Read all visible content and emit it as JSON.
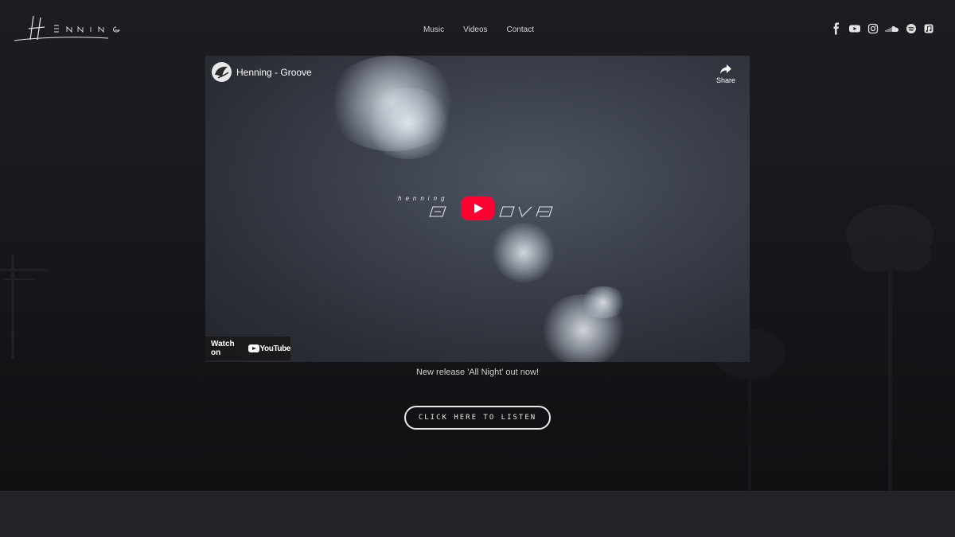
{
  "header": {
    "logo_alt": "Henning",
    "nav": [
      {
        "label": "Music"
      },
      {
        "label": "Videos"
      },
      {
        "label": "Contact"
      }
    ],
    "social_icons": [
      "facebook-icon",
      "youtube-icon",
      "instagram-icon",
      "soundcloud-icon",
      "spotify-icon",
      "apple-music-icon"
    ]
  },
  "video": {
    "title": "Henning - Groove",
    "share_label": "Share",
    "watch_on_label": "Watch on",
    "youtube_word": "YouTube",
    "overlay_small_text": "henning"
  },
  "main": {
    "caption": "New release 'All Night' out now!",
    "cta_label": "CLICK HERE TO LISTEN"
  },
  "colors": {
    "background": "#16171b",
    "play_button": "#ff0033",
    "text": "#d8d8d8"
  }
}
